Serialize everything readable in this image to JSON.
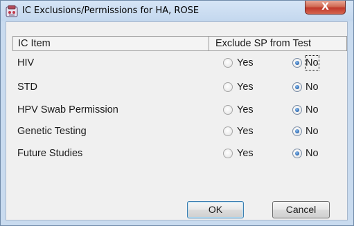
{
  "window": {
    "title": "IC Exclusions/Permissions for HA, ROSE",
    "close_label": "X"
  },
  "grid": {
    "headers": {
      "item": "IC Item",
      "exclude": "Exclude SP from Test"
    },
    "rows": [
      {
        "label": "HIV",
        "yes": "Yes",
        "no": "No",
        "selected": "no"
      },
      {
        "label": "STD",
        "yes": "Yes",
        "no": "No",
        "selected": "no"
      },
      {
        "label": "HPV Swab Permission",
        "yes": "Yes",
        "no": "No",
        "selected": "no"
      },
      {
        "label": "Genetic Testing",
        "yes": "Yes",
        "no": "No",
        "selected": "no"
      },
      {
        "label": "Future Studies",
        "yes": "Yes",
        "no": "No",
        "selected": "no"
      }
    ]
  },
  "buttons": {
    "ok": "OK",
    "cancel": "Cancel"
  },
  "colors": {
    "titlebar": "#c9dbef",
    "close": "#c0392b",
    "radio_selected": "#2a66b0"
  }
}
